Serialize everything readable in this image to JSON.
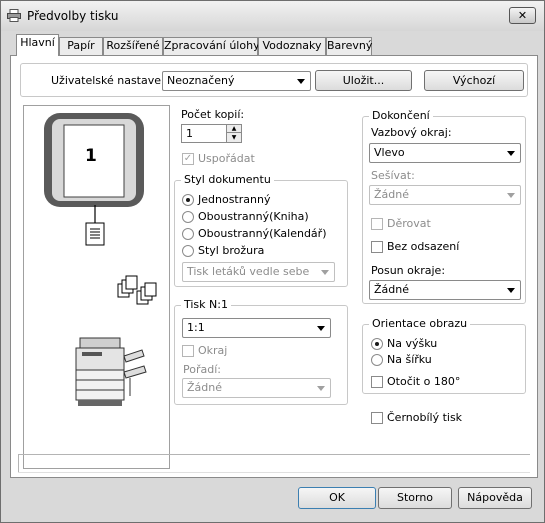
{
  "window": {
    "title": "Předvolby tisku",
    "close_label": "✕"
  },
  "tabs": [
    "Hlavní",
    "Papír",
    "Rozšířené",
    "Zpracování úlohy",
    "Vodoznaky",
    "Barevný"
  ],
  "user_settings": {
    "label": "Uživatelské nastavení:",
    "value": "Neoznačený",
    "save_label": "Uložit...",
    "default_label": "Výchozí"
  },
  "preview": {
    "page_number": "1"
  },
  "copies": {
    "label": "Počet kopií:",
    "value": "1",
    "collate_label": "Uspořádat"
  },
  "document_style": {
    "title": "Styl dokumentu",
    "options": [
      "Jednostranný",
      "Oboustranný(Kniha)",
      "Oboustranný(Kalendář)",
      "Styl brožura"
    ],
    "selected": "Jednostranný",
    "booklet_combo": "Tisk letáků vedle sebe"
  },
  "n_up": {
    "title": "Tisk N:1",
    "value": "1:1",
    "border_label": "Okraj",
    "order_label": "Pořadí:",
    "order_value": "Žádné"
  },
  "finishing": {
    "title": "Dokončení",
    "binding_label": "Vazbový okraj:",
    "binding_value": "Vlevo",
    "staple_label": "Sešívat:",
    "staple_value": "Žádné",
    "punch_label": "Děrovat",
    "no_offset_label": "Bez odsazení",
    "shift_label": "Posun okraje:",
    "shift_value": "Žádné"
  },
  "orientation": {
    "title": "Orientace obrazu",
    "options": [
      "Na výšku",
      "Na šířku"
    ],
    "selected": "Na výšku",
    "rotate_label": "Otočit o 180°"
  },
  "bw_label": "Černobílý tisk",
  "footer": {
    "ok": "OK",
    "cancel": "Storno",
    "help": "Nápověda"
  }
}
